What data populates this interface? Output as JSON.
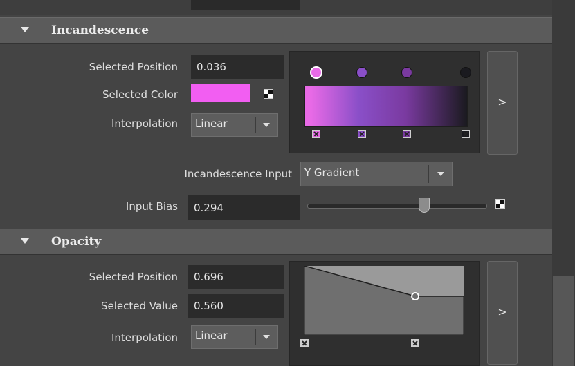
{
  "incandescence": {
    "title": "Incandescence",
    "selected_position_label": "Selected Position",
    "selected_position_value": "0.036",
    "selected_color_label": "Selected Color",
    "selected_color": "#f25ef2",
    "interpolation_label": "Interpolation",
    "interpolation_value": "Linear",
    "gradient_stops": [
      {
        "position": 0.036,
        "color": "#e86ae6",
        "selected": true
      },
      {
        "position": 0.33,
        "color": "#8a4fc8",
        "selected": false
      },
      {
        "position": 0.62,
        "color": "#7a3aa0",
        "selected": false
      },
      {
        "position": 1.0,
        "color": "#1a1a1f",
        "selected": false
      }
    ],
    "expand_label": ">",
    "input_label": "Incandescence Input",
    "input_value": "Y Gradient",
    "input_bias_label": "Input Bias",
    "input_bias_value": "0.294",
    "input_bias_slider": 0.65
  },
  "opacity": {
    "title": "Opacity",
    "selected_position_label": "Selected Position",
    "selected_position_value": "0.696",
    "selected_value_label": "Selected Value",
    "selected_value": "0.560",
    "interpolation_label": "Interpolation",
    "interpolation_value": "Linear",
    "curve_points": [
      {
        "position": 0.0,
        "value": 1.0
      },
      {
        "position": 0.696,
        "value": 0.56
      }
    ],
    "expand_label": ">"
  },
  "colors": {
    "background": "#444444",
    "section_header": "#5b5b5b",
    "field": "#2b2b2b"
  }
}
